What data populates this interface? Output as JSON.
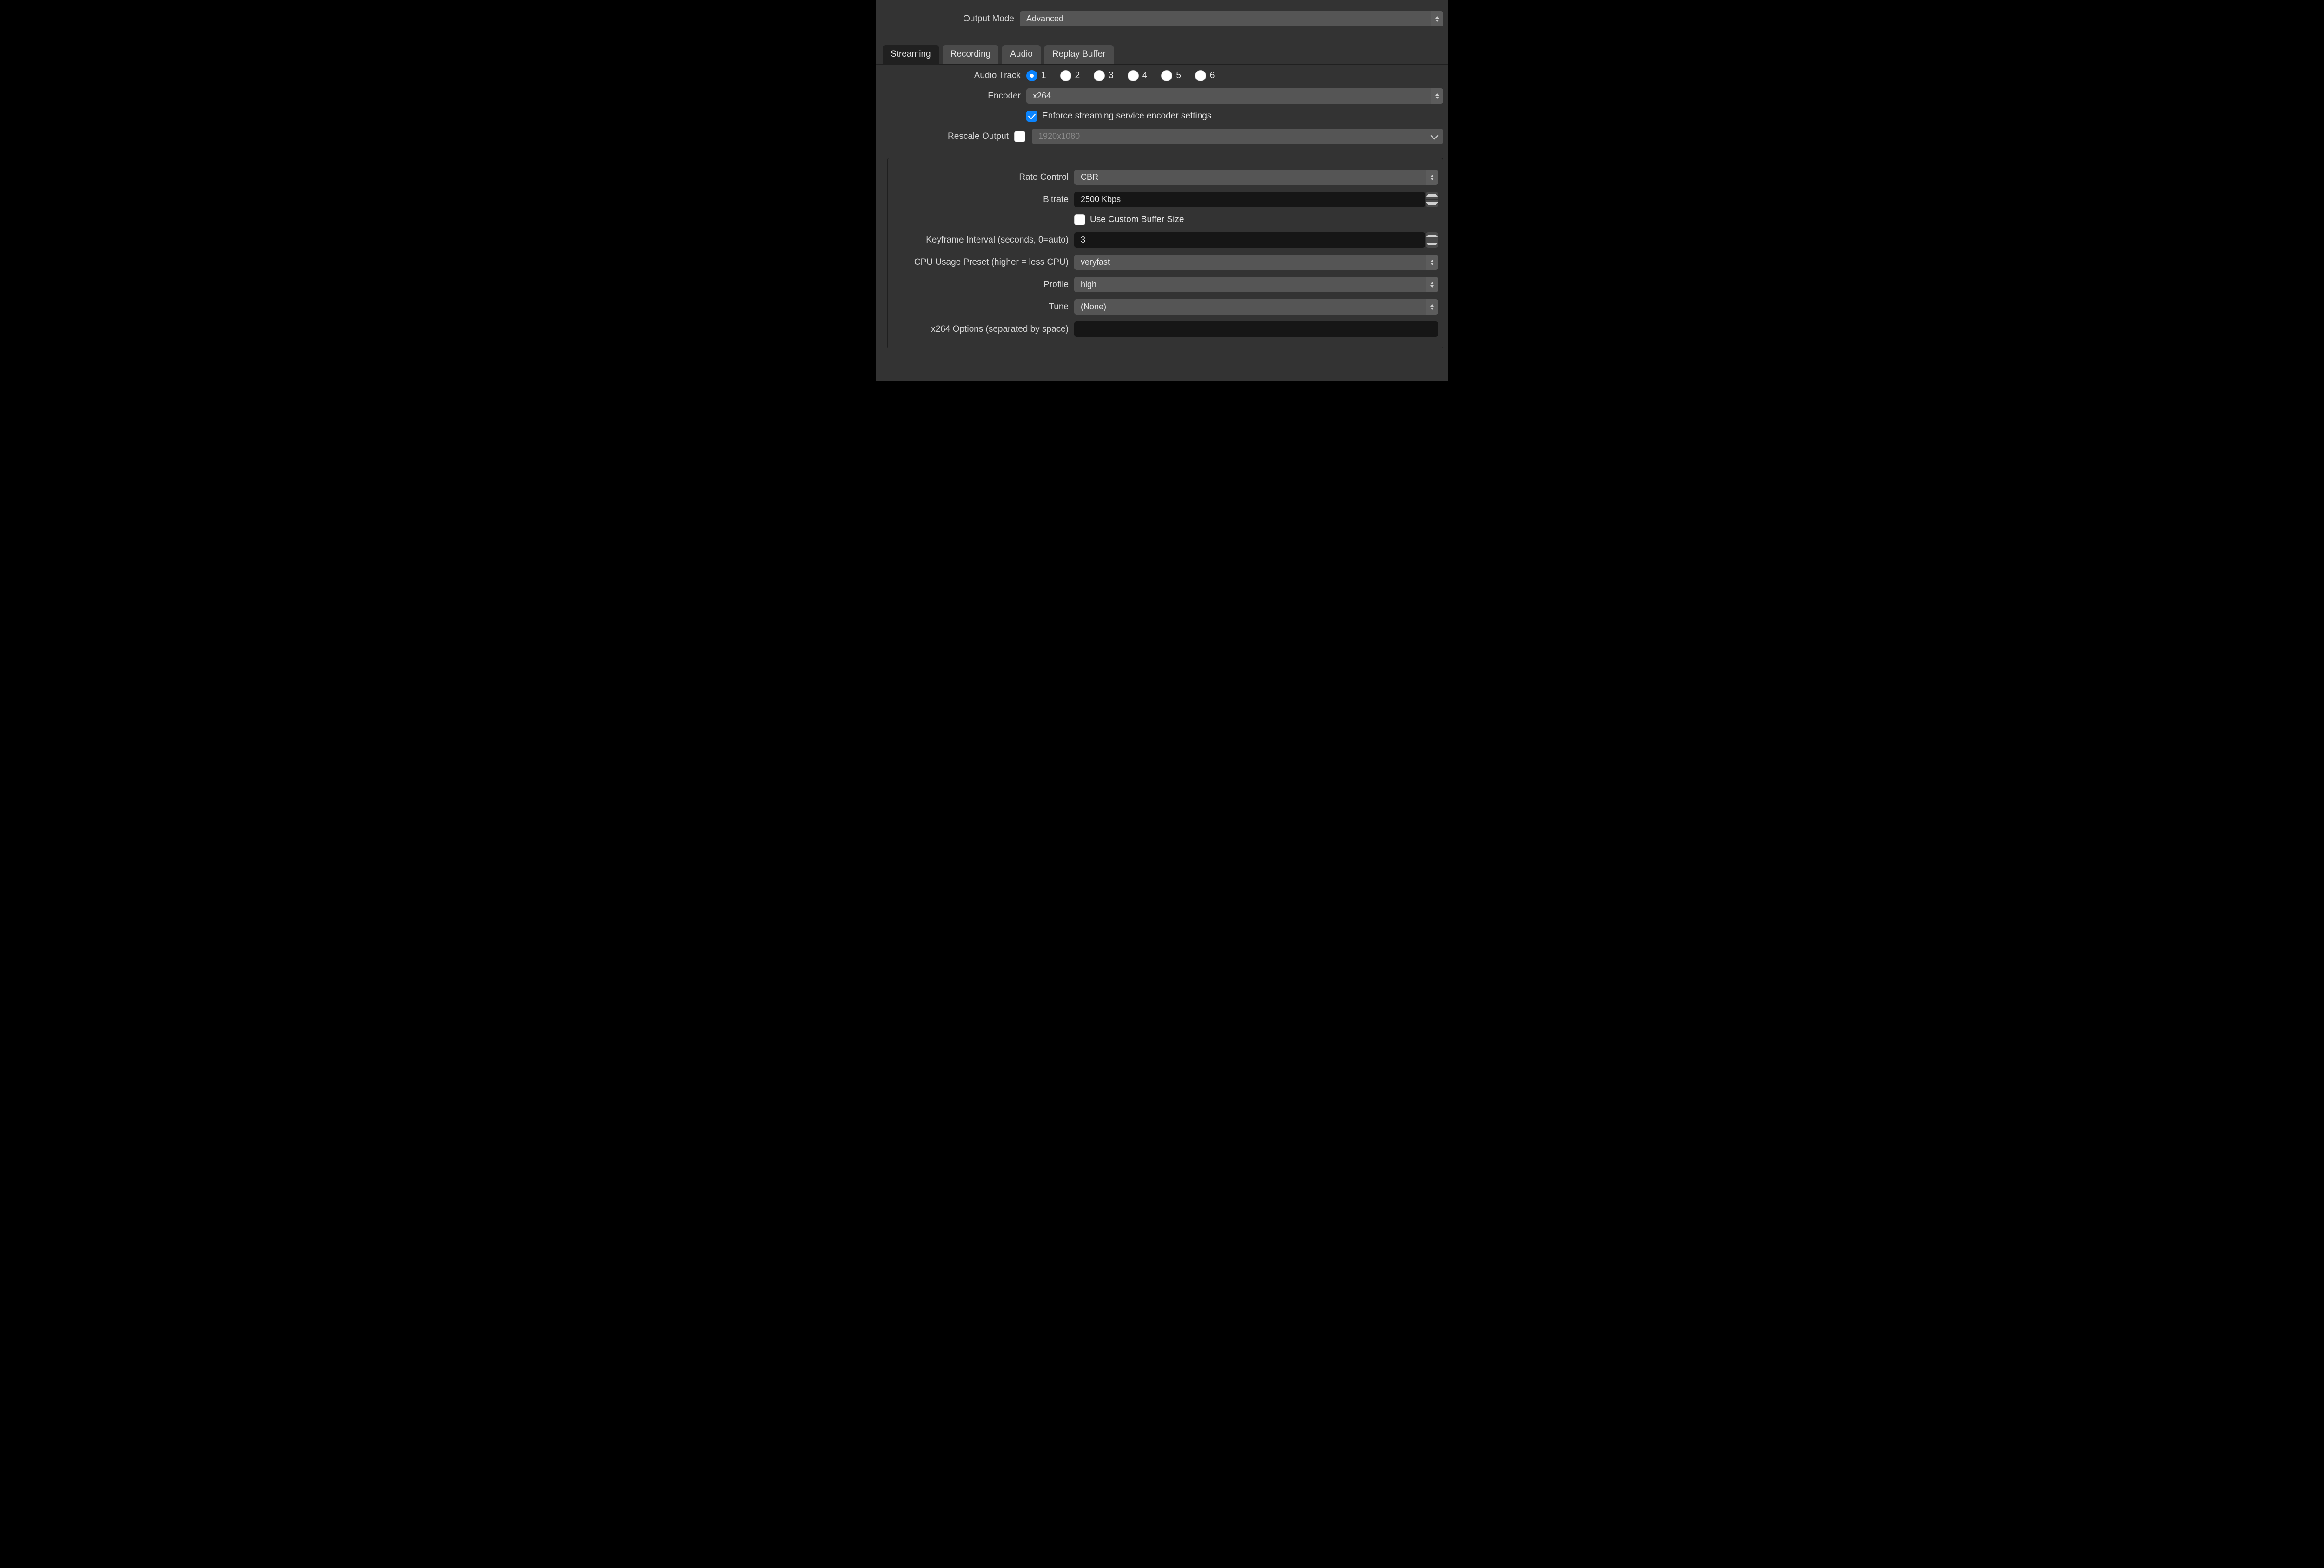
{
  "outputMode": {
    "label": "Output Mode",
    "value": "Advanced"
  },
  "tabs": {
    "streaming": "Streaming",
    "recording": "Recording",
    "audio": "Audio",
    "replay": "Replay Buffer"
  },
  "streaming": {
    "audioTrack": {
      "label": "Audio Track",
      "options": [
        "1",
        "2",
        "3",
        "4",
        "5",
        "6"
      ],
      "selected": "1"
    },
    "encoder": {
      "label": "Encoder",
      "value": "x264"
    },
    "enforce": {
      "label": "Enforce streaming service encoder settings",
      "checked": true
    },
    "rescale": {
      "label": "Rescale Output",
      "checked": false,
      "value": "1920x1080"
    }
  },
  "encoder": {
    "rateControl": {
      "label": "Rate Control",
      "value": "CBR"
    },
    "bitrate": {
      "label": "Bitrate",
      "value": "2500 Kbps"
    },
    "customBuffer": {
      "label": "Use Custom Buffer Size",
      "checked": false
    },
    "keyframe": {
      "label": "Keyframe Interval (seconds, 0=auto)",
      "value": "3"
    },
    "cpuPreset": {
      "label": "CPU Usage Preset (higher = less CPU)",
      "value": "veryfast"
    },
    "profile": {
      "label": "Profile",
      "value": "high"
    },
    "tune": {
      "label": "Tune",
      "value": "(None)"
    },
    "x264opts": {
      "label": "x264 Options (separated by space)",
      "value": ""
    }
  }
}
